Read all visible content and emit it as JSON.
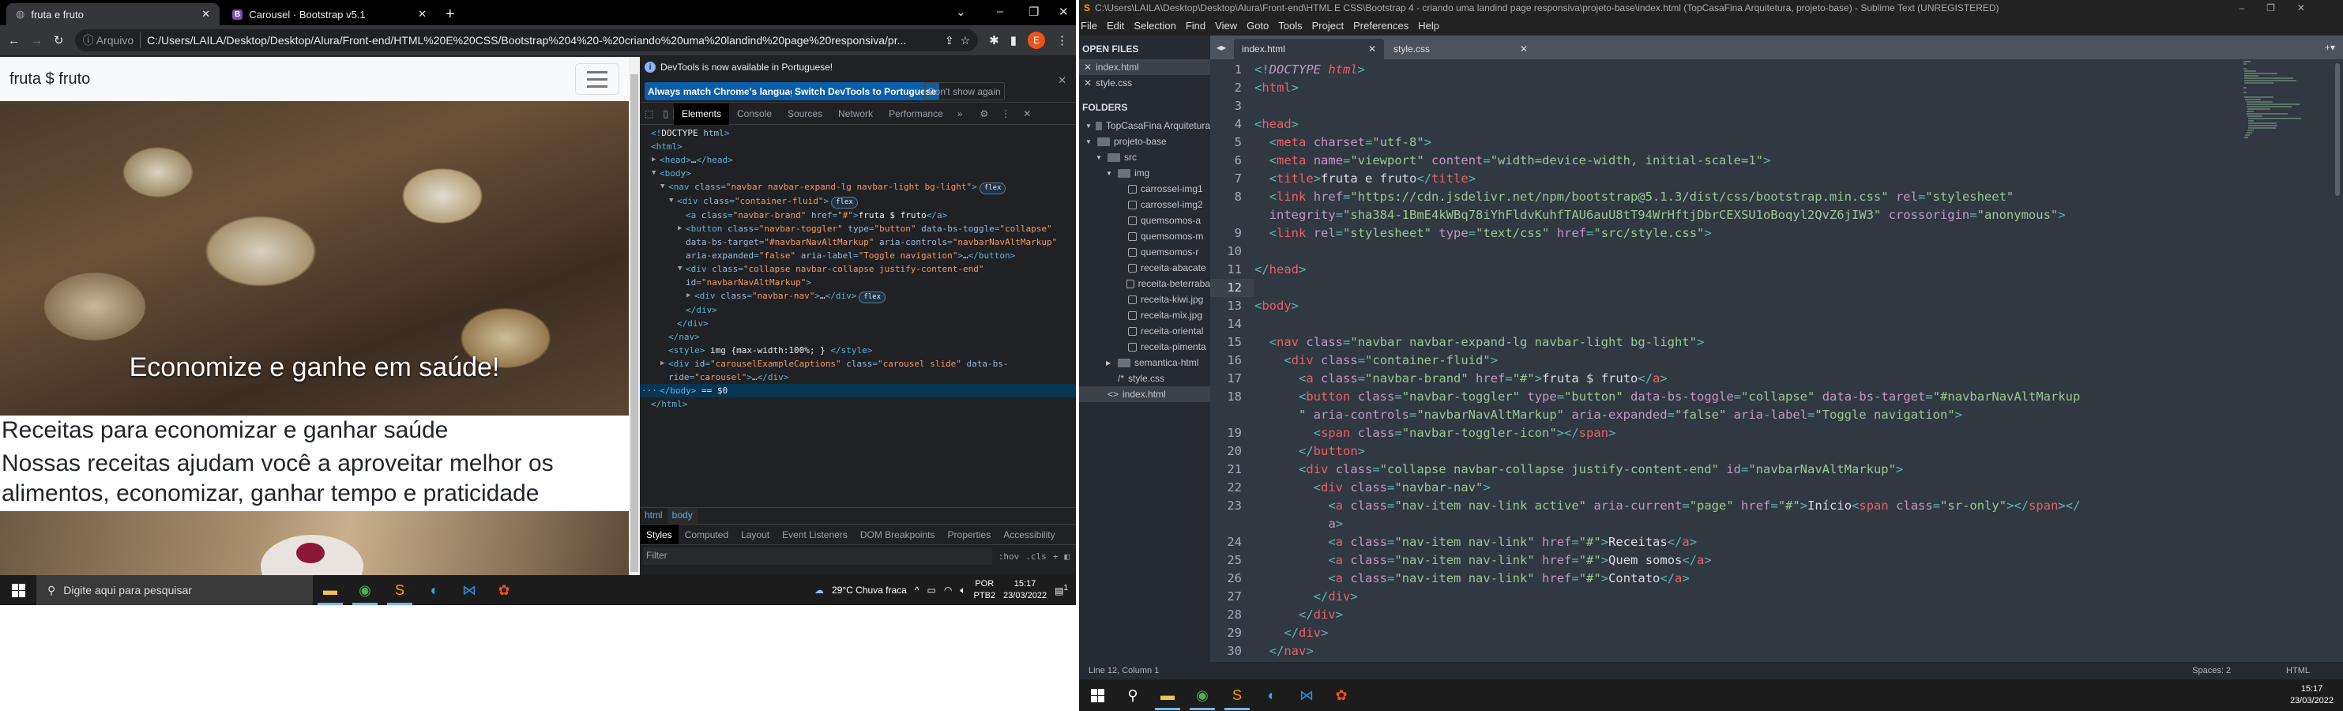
{
  "browser": {
    "tabs": [
      {
        "title": "fruta e fruto",
        "icon": "globe-icon",
        "active": true
      },
      {
        "title": "Carousel · Bootstrap v5.1",
        "icon": "bootstrap-icon",
        "active": false
      }
    ],
    "address": {
      "security_label": "Arquivo",
      "url": "C:/Users/LAILA/Desktop/Desktop/Alura/Front-end/HTML%20E%20CSS/Bootstrap%204%20-%20criando%20uma%20landind%20page%20responsiva/pr...",
      "profile_initial": "E"
    },
    "page": {
      "brand": "fruta $ fruto",
      "carousel_caption": "Economize e ganhe em saúde!",
      "heading": "Receitas para economizar e ganhar saúde",
      "paragraph": "Nossas receitas ajudam você a aproveitar melhor os alimentos, economizar, ganhar tempo e praticidade"
    }
  },
  "devtools": {
    "notice": "DevTools is now available in Portuguese!",
    "notice_buttons": [
      "Always match Chrome's language",
      "Switch DevTools to Portuguese",
      "Don't show again"
    ],
    "tabs": [
      "Elements",
      "Console",
      "Sources",
      "Network",
      "Performance"
    ],
    "active_tab": "Elements",
    "dom": [
      {
        "i": 0,
        "tri": "",
        "t": "<!DOCTYPE html>"
      },
      {
        "i": 0,
        "tri": "",
        "t": "<html>"
      },
      {
        "i": 1,
        "tri": "▶",
        "t": "<head>…</head>"
      },
      {
        "i": 1,
        "tri": "▼",
        "t": "<body>"
      },
      {
        "i": 2,
        "tri": "▼",
        "t": "<nav class=\"navbar navbar-expand-lg navbar-light bg-light\">",
        "badge": "flex"
      },
      {
        "i": 3,
        "tri": "▼",
        "t": "<div class=\"container-fluid\">",
        "badge": "flex"
      },
      {
        "i": 4,
        "tri": "",
        "t": "<a class=\"navbar-brand\" href=\"#\">fruta $ fruto</a>"
      },
      {
        "i": 4,
        "tri": "▶",
        "t": "<button class=\"navbar-toggler\" type=\"button\" data-bs-toggle=\"collapse\" data-bs-target=\"#navbarNavAltMarkup\" aria-controls=\"navbarNavAltMarkup\" aria-expanded=\"false\" aria-label=\"Toggle navigation\">…</button>"
      },
      {
        "i": 4,
        "tri": "▼",
        "t": "<div class=\"collapse navbar-collapse justify-content-end\" id=\"navbarNavAltMarkup\">"
      },
      {
        "i": 5,
        "tri": "▶",
        "t": "<div class=\"navbar-nav\">…</div>",
        "badge": "flex"
      },
      {
        "i": 4,
        "tri": "",
        "t": "</div>"
      },
      {
        "i": 3,
        "tri": "",
        "t": "</div>"
      },
      {
        "i": 2,
        "tri": "",
        "t": "</nav>"
      },
      {
        "i": 2,
        "tri": "",
        "t": "<style> img {max-width:100%; } </style>"
      },
      {
        "i": 2,
        "tri": "▶",
        "t": "<div id=\"carouselExampleCaptions\" class=\"carousel slide\" data-bs-ride=\"carousel\">…</div>"
      },
      {
        "i": 1,
        "tri": "",
        "t": "</body> == $0",
        "selected": true
      },
      {
        "i": 0,
        "tri": "",
        "t": "</html>"
      }
    ],
    "breadcrumbs": [
      "html",
      "body"
    ],
    "style_tabs": [
      "Styles",
      "Computed",
      "Layout",
      "Event Listeners",
      "DOM Breakpoints",
      "Properties",
      "Accessibility"
    ],
    "filter_placeholder": "Filter",
    "filter_tools": [
      ":hov",
      ".cls",
      "+"
    ]
  },
  "taskbar_left": {
    "search_placeholder": "Digite aqui para pesquisar",
    "apps": [
      "file-explorer-icon",
      "chrome-icon",
      "sublime-icon",
      "edge-icon",
      "vscode-icon",
      "figma-icon"
    ],
    "weather": "29°C  Chuva fraca",
    "lang": "POR",
    "layout": "PTB2",
    "time": "15:17",
    "date": "23/03/2022",
    "notifications": "1"
  },
  "sublime": {
    "title": "C:\\Users\\LAILA\\Desktop\\Desktop\\Alura\\Front-end\\HTML E CSS\\Bootstrap 4 - criando uma landind page responsiva\\projeto-base\\index.html (TopCasaFina Arquitetura, projeto-base) - Sublime Text (UNREGISTERED)",
    "menu": [
      "File",
      "Edit",
      "Selection",
      "Find",
      "View",
      "Goto",
      "Tools",
      "Project",
      "Preferences",
      "Help"
    ],
    "open_files_label": "OPEN FILES",
    "open_files": [
      "index.html",
      "style.css"
    ],
    "folders_label": "FOLDERS",
    "tree": [
      {
        "d": 0,
        "k": "folder-open",
        "n": "TopCasaFina Arquitetura"
      },
      {
        "d": 0,
        "k": "folder-open",
        "n": "projeto-base"
      },
      {
        "d": 1,
        "k": "folder-open",
        "n": "src"
      },
      {
        "d": 2,
        "k": "folder-open",
        "n": "img"
      },
      {
        "d": 3,
        "k": "image",
        "n": "carrossel-img1"
      },
      {
        "d": 3,
        "k": "image",
        "n": "carrossel-img2"
      },
      {
        "d": 3,
        "k": "image",
        "n": "quemsomos-a"
      },
      {
        "d": 3,
        "k": "image",
        "n": "quemsomos-m"
      },
      {
        "d": 3,
        "k": "image",
        "n": "quemsomos-r"
      },
      {
        "d": 3,
        "k": "image",
        "n": "receita-abacate"
      },
      {
        "d": 3,
        "k": "image",
        "n": "receita-beterraba"
      },
      {
        "d": 3,
        "k": "image",
        "n": "receita-kiwi.jpg"
      },
      {
        "d": 3,
        "k": "image",
        "n": "receita-mix.jpg"
      },
      {
        "d": 3,
        "k": "image",
        "n": "receita-oriental"
      },
      {
        "d": 3,
        "k": "image",
        "n": "receita-pimenta"
      },
      {
        "d": 2,
        "k": "folder-closed",
        "n": "semantica-html"
      },
      {
        "d": 2,
        "k": "css",
        "n": "style.css"
      },
      {
        "d": 1,
        "k": "html",
        "n": "index.html",
        "selected": true
      }
    ],
    "tabs": [
      "index.html",
      "style.css"
    ],
    "active_tab": "index.html",
    "current_line": "12",
    "code": [
      {
        "n": "1",
        "t": "<!DOCTYPE html>"
      },
      {
        "n": "2",
        "t": "<html>"
      },
      {
        "n": "3",
        "t": ""
      },
      {
        "n": "4",
        "t": "<head>"
      },
      {
        "n": "5",
        "t": "  <meta charset=\"utf-8\">"
      },
      {
        "n": "6",
        "t": "  <meta name=\"viewport\" content=\"width=device-width, initial-scale=1\">"
      },
      {
        "n": "7",
        "t": "  <title>fruta e fruto</title>"
      },
      {
        "n": "8",
        "t": "  <link href=\"https://cdn.jsdelivr.net/npm/bootstrap@5.1.3/dist/css/bootstrap.min.css\" rel=\"stylesheet\""
      },
      {
        "n": "",
        "s": "attr",
        "t": "  integrity=\"sha384-1BmE4kWBq78iYhFldvKuhfTAU6auU8tT94WrHftjDbrCEXSU1oBoqyl2QvZ6jIW3\" crossorigin=\"anonymous\">"
      },
      {
        "n": "9",
        "t": "  <link rel=\"stylesheet\" type=\"text/css\" href=\"src/style.css\">"
      },
      {
        "n": "10",
        "t": ""
      },
      {
        "n": "11",
        "t": "</head>"
      },
      {
        "n": "12",
        "t": ""
      },
      {
        "n": "13",
        "t": "<body>"
      },
      {
        "n": "14",
        "t": ""
      },
      {
        "n": "15",
        "t": "  <nav class=\"navbar navbar-expand-lg navbar-light bg-light\">"
      },
      {
        "n": "16",
        "t": "    <div class=\"container-fluid\">"
      },
      {
        "n": "17",
        "t": "      <a class=\"navbar-brand\" href=\"#\">fruta $ fruto</a>"
      },
      {
        "n": "18",
        "t": "      <button class=\"navbar-toggler\" type=\"button\" data-bs-toggle=\"collapse\" data-bs-target=\"#navbarNavAltMarkup"
      },
      {
        "n": "",
        "s": "str",
        "t": "      \" aria-controls=\"navbarNavAltMarkup\" aria-expanded=\"false\" aria-label=\"Toggle navigation\">"
      },
      {
        "n": "19",
        "t": "        <span class=\"navbar-toggler-icon\"></span>"
      },
      {
        "n": "20",
        "t": "      </button>"
      },
      {
        "n": "21",
        "t": "      <div class=\"collapse navbar-collapse justify-content-end\" id=\"navbarNavAltMarkup\">"
      },
      {
        "n": "22",
        "t": "        <div class=\"navbar-nav\">"
      },
      {
        "n": "23",
        "t": "          <a class=\"nav-item nav-link active\" aria-current=\"page\" href=\"#\">Início<span class=\"sr-only\"></span></"
      },
      {
        "n": "",
        "s": "tag",
        "t": "          a>"
      },
      {
        "n": "24",
        "t": "          <a class=\"nav-item nav-link\" href=\"#\">Receitas</a>"
      },
      {
        "n": "25",
        "t": "          <a class=\"nav-item nav-link\" href=\"#\">Quem somos</a>"
      },
      {
        "n": "26",
        "t": "          <a class=\"nav-item nav-link\" href=\"#\">Contato</a>"
      },
      {
        "n": "27",
        "t": "        </div>"
      },
      {
        "n": "28",
        "t": "      </div>"
      },
      {
        "n": "29",
        "t": "    </div>"
      },
      {
        "n": "30",
        "t": "  </nav>"
      }
    ],
    "status": {
      "position": "Line 12, Column 1",
      "indent": "Spaces: 2",
      "syntax": "HTML"
    }
  },
  "taskbar_right": {
    "apps": [
      "file-explorer-icon",
      "chrome-icon",
      "sublime-icon",
      "edge-icon",
      "vscode-icon",
      "figma-icon"
    ],
    "time": "15:17",
    "date": "23/03/2022"
  }
}
